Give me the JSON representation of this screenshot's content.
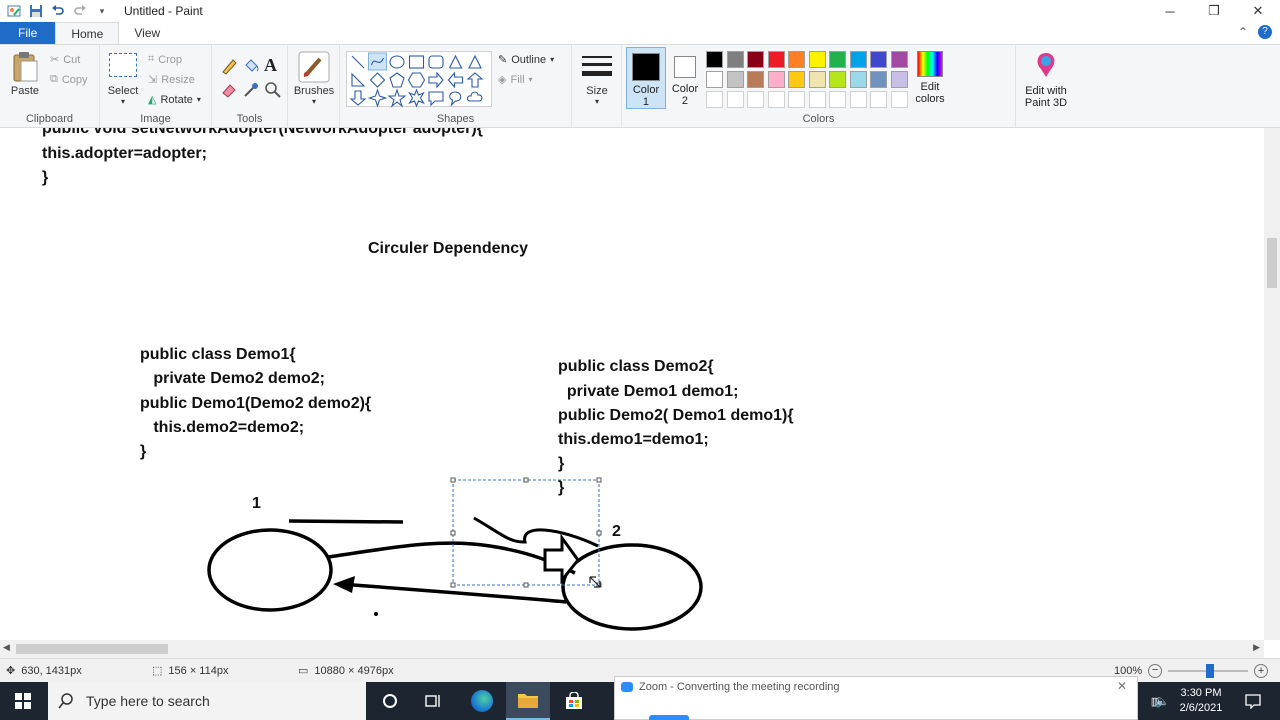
{
  "window": {
    "title": "Untitled - Paint"
  },
  "tabs": {
    "file": "File",
    "home": "Home",
    "view": "View"
  },
  "ribbon": {
    "clipboard": {
      "label": "Clipboard",
      "paste": "Paste",
      "cut": "Cut",
      "copy": "Copy"
    },
    "image": {
      "label": "Image",
      "select": "Select",
      "crop": "Crop",
      "resize": "Resize",
      "rotate": "Rotate"
    },
    "tools": {
      "label": "Tools"
    },
    "brushes": {
      "label": "Brushes"
    },
    "shapes": {
      "label": "Shapes",
      "outline": "Outline",
      "fill": "Fill"
    },
    "size": {
      "label": "Size"
    },
    "colors": {
      "label": "Colors",
      "color1": "Color\n1",
      "color2": "Color\n2",
      "edit": "Edit\ncolors",
      "paint3d": "Edit with\nPaint 3D",
      "color1_value": "#000000",
      "color2_value": "#ffffff",
      "palette_row1": [
        "#000000",
        "#7f7f7f",
        "#880015",
        "#ed1c24",
        "#ff7f27",
        "#fff200",
        "#22b14c",
        "#00a2e8",
        "#3f48cc",
        "#a349a4"
      ],
      "palette_row2": [
        "#ffffff",
        "#c3c3c3",
        "#b97a57",
        "#ffaec9",
        "#ffc90e",
        "#efe4b0",
        "#b5e61d",
        "#99d9ea",
        "#7092be",
        "#c8bfe7"
      ]
    }
  },
  "canvas": {
    "lines": {
      "l0": "public void setNetworkAdopter(NetworkAdopter adopter){",
      "l1": "this.adopter=adopter;",
      "l2": "}",
      "heading": "Circuler Dependency",
      "d1_0": "public class Demo1{",
      "d1_1": "   private Demo2 demo2;",
      "d1_2": "public Demo1(Demo2 demo2){",
      "d1_3": "   this.demo2=demo2;",
      "d1_4": "}",
      "d2_0": "public class Demo2{",
      "d2_1": "  private Demo1 demo1;",
      "d2_2": "public Demo2( Demo1 demo1){",
      "d2_3": "this.demo1=demo1;",
      "d2_4": "}",
      "d2_5": "}",
      "n1": "1",
      "n2": "2"
    }
  },
  "status": {
    "cursor_pos": "630, 1431px",
    "selection_size": "156 × 114px",
    "image_size": "10880 × 4976px",
    "zoom": "100%"
  },
  "taskbar": {
    "search_placeholder": "Type here to search",
    "time": "3:30 PM",
    "date": "2/6/2021",
    "toast": "Zoom - Converting the meeting recording"
  }
}
